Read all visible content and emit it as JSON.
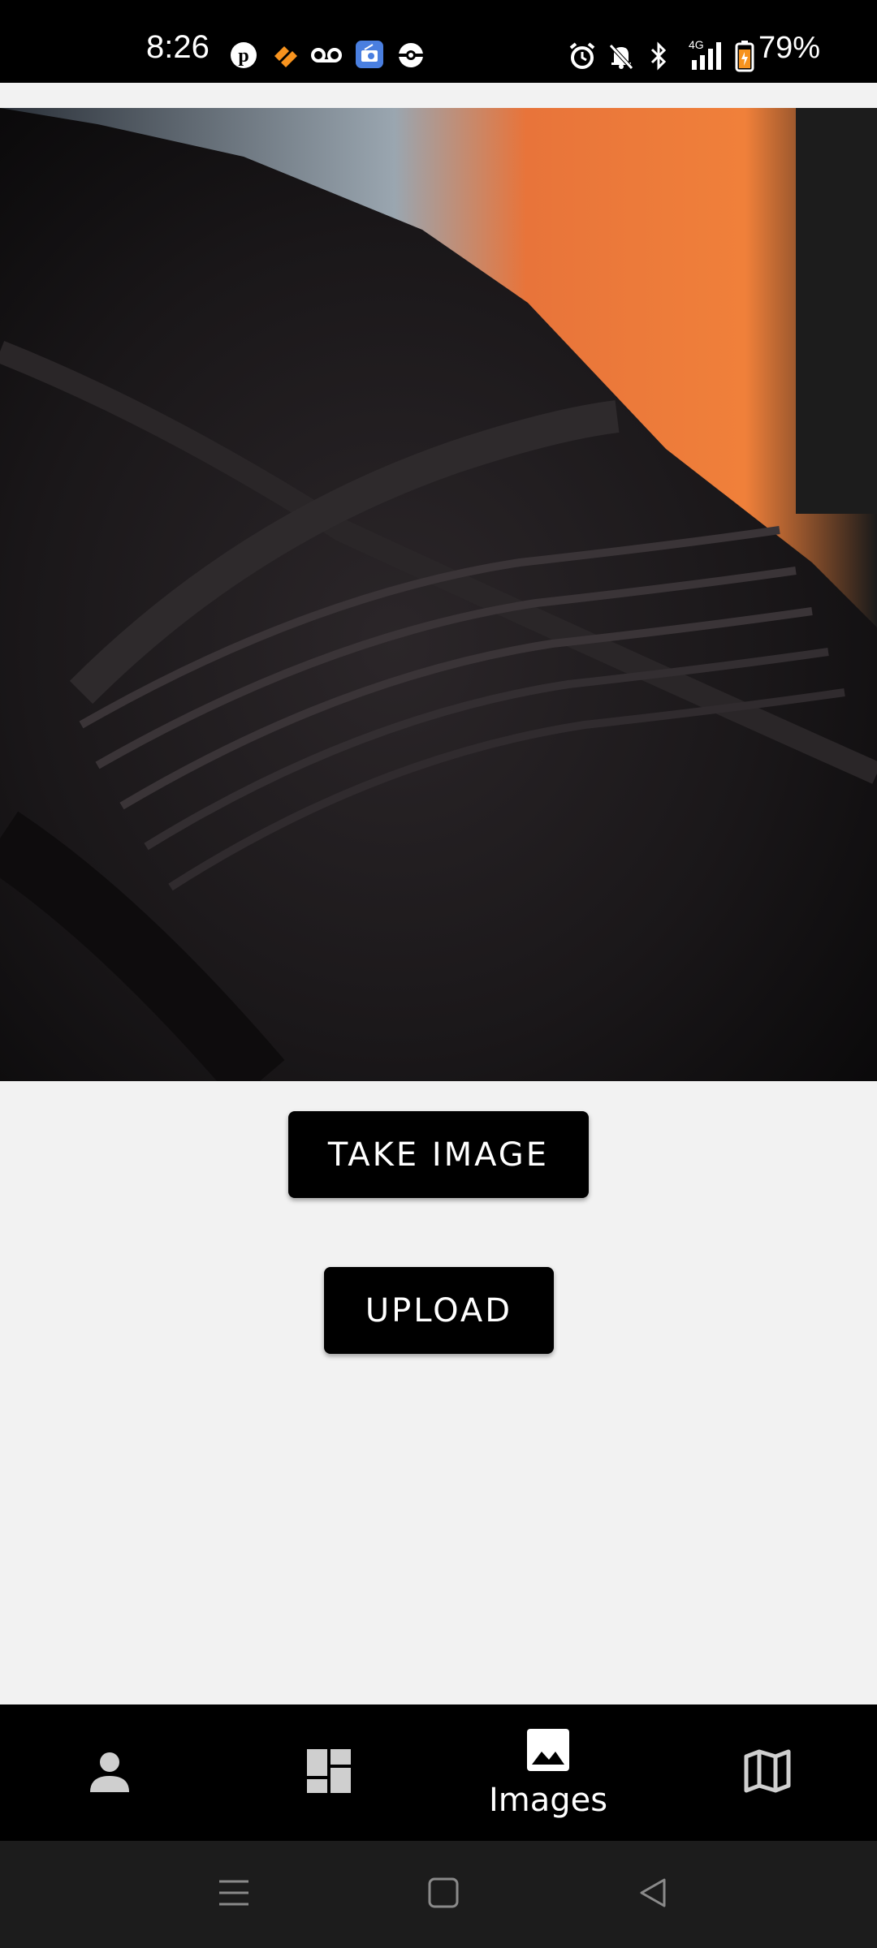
{
  "status_bar": {
    "time": "8:26",
    "battery_percent": "79%",
    "network": "4G",
    "left_icons": [
      "pinterest-icon",
      "app-heart-icon",
      "voicemail-icon",
      "radio-icon",
      "pokeball-icon"
    ],
    "right_icons": [
      "alarm-icon",
      "mute-bell-icon",
      "bluetooth-icon",
      "signal-icon",
      "battery-icon"
    ]
  },
  "photo": {
    "description_icon": "photo-preview"
  },
  "actions": {
    "take_image_label": "TAKE IMAGE",
    "upload_label": "UPLOAD"
  },
  "bottom_nav": {
    "items": [
      {
        "icon": "person-icon",
        "label": ""
      },
      {
        "icon": "dashboard-icon",
        "label": ""
      },
      {
        "icon": "image-icon",
        "label": "Images"
      },
      {
        "icon": "map-icon",
        "label": ""
      }
    ],
    "active_index": 2
  },
  "colors": {
    "background": "#f2f2f2",
    "bar": "#000000",
    "button": "#000000",
    "button_text": "#ffffff",
    "inactive_icon": "#cfcfcf"
  }
}
